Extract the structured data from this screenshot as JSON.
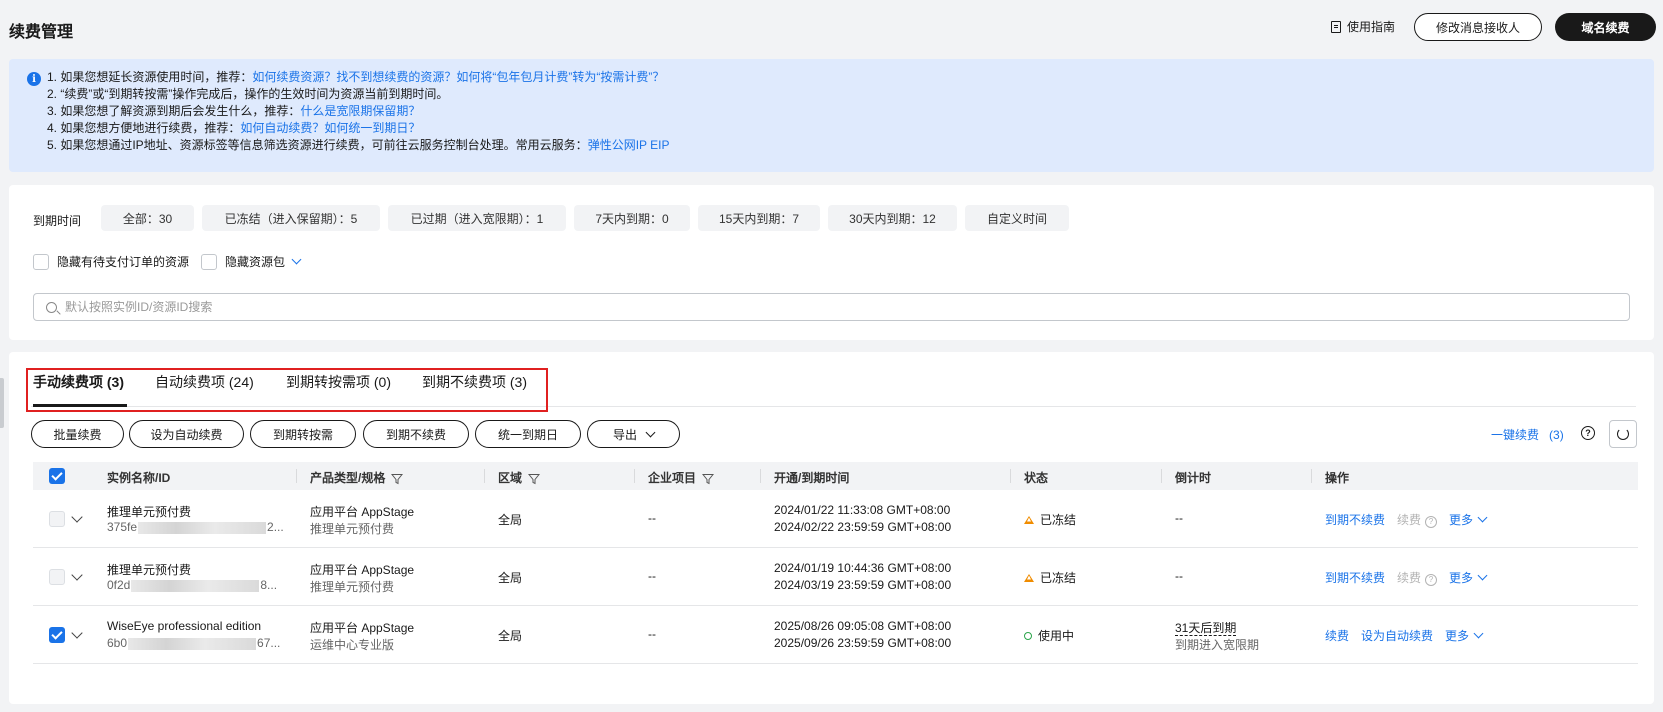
{
  "header": {
    "title": "续费管理",
    "guide_label": "使用指南",
    "modify_receiver_label": "修改消息接收人",
    "domain_renew_label": "域名续费"
  },
  "info": {
    "lines": [
      {
        "text": "1. 如果您想延长资源使用时间，推荐：",
        "link": "如何续费资源？找不到想续费的资源？如何将“包年包月计费”转为“按需计费”？"
      },
      {
        "text": "2. “续费”或“到期转按需”操作完成后，操作的生效时间为资源当前到期时间。",
        "link": ""
      },
      {
        "text": "3. 如果您想了解资源到期后会发生什么，推荐：",
        "link": "什么是宽限期保留期？"
      },
      {
        "text": "4. 如果您想方便地进行续费，推荐：",
        "link": "如何自动续费？如何统一到期日？"
      },
      {
        "text": "5. 如果您想通过IP地址、资源标签等信息筛选资源进行续费，可前往云服务控制台处理。常用云服务：",
        "link": "弹性公网IP EIP"
      }
    ]
  },
  "filter": {
    "expiry_label": "到期时间",
    "chips": [
      "全部：30",
      "已冻结（进入保留期）：5",
      "已过期（进入宽限期）：1",
      "7天内到期：0",
      "15天内到期：7",
      "30天内到期：12",
      "自定义时间"
    ],
    "hide_pending_label": "隐藏有待支付订单的资源",
    "hide_package_label": "隐藏资源包",
    "search_placeholder": "默认按照实例ID/资源ID搜索"
  },
  "tabs": [
    "手动续费项 (3)",
    "自动续费项 (24)",
    "到期转按需项 (0)",
    "到期不续费项 (3)"
  ],
  "actions": {
    "buttons": [
      "批量续费",
      "设为自动续费",
      "到期转按需",
      "到期不续费",
      "统一到期日",
      "导出"
    ],
    "onekey_label": "一键续费",
    "onekey_count": "(3)"
  },
  "table": {
    "headers": [
      "实例名称/ID",
      "产品类型/规格",
      "区域",
      "企业项目",
      "开通/到期时间",
      "状态",
      "倒计时",
      "操作"
    ],
    "rows": [
      {
        "name": "推理单元预付费",
        "id_prefix": "375fe",
        "id_suffix": "2...",
        "product": "应用平台 AppStage",
        "spec": "推理单元预付费",
        "region": "全局",
        "project": "--",
        "start": "2024/01/22 11:33:08 GMT+08:00",
        "end": "2024/02/22 23:59:59 GMT+08:00",
        "status": "已冻结",
        "countdown": "--",
        "countdown_sub": "",
        "op1": "到期不续费",
        "op2": "续费",
        "more": "更多",
        "checked": false
      },
      {
        "name": "推理单元预付费",
        "id_prefix": "0f2d",
        "id_suffix": "8...",
        "product": "应用平台 AppStage",
        "spec": "推理单元预付费",
        "region": "全局",
        "project": "--",
        "start": "2024/01/19 10:44:36 GMT+08:00",
        "end": "2024/03/19 23:59:59 GMT+08:00",
        "status": "已冻结",
        "countdown": "--",
        "countdown_sub": "",
        "op1": "到期不续费",
        "op2": "续费",
        "more": "更多",
        "checked": false
      },
      {
        "name": "WiseEye professional edition",
        "id_prefix": "6b0",
        "id_suffix": "67...",
        "product": "应用平台 AppStage",
        "spec": "运维中心专业版",
        "region": "全局",
        "project": "--",
        "start": "2025/08/26 09:05:08 GMT+08:00",
        "end": "2025/09/26 23:59:59 GMT+08:00",
        "status": "使用中",
        "countdown": "31天后到期",
        "countdown_sub": "到期进入宽限期",
        "op1": "续费",
        "op2": "设为自动续费",
        "more": "更多",
        "checked": true
      }
    ]
  },
  "colors": {
    "accent": "#1a73e8",
    "frozen": "#f08c00",
    "active": "#2ba44a",
    "highlight_box": "#e02020"
  }
}
